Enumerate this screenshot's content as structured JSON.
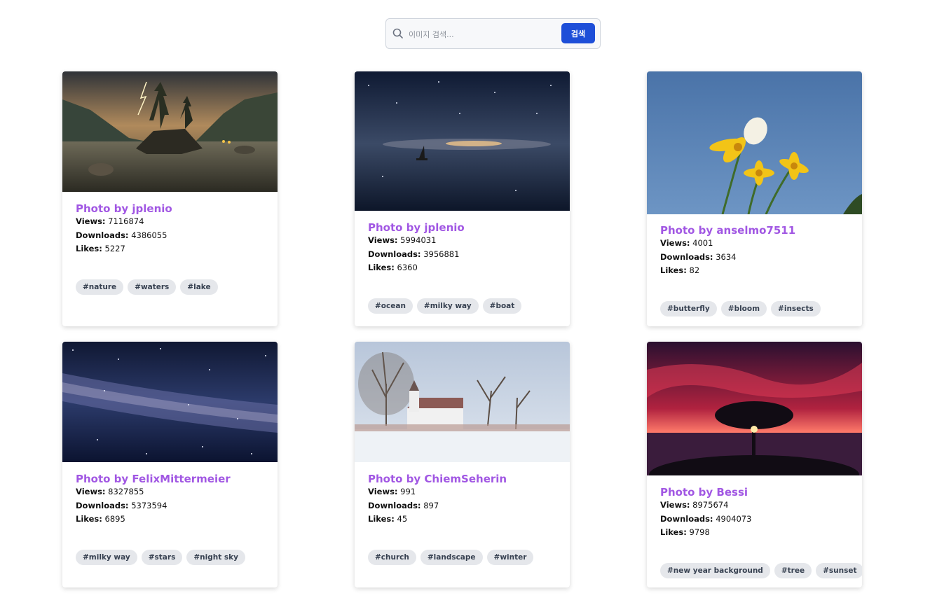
{
  "search": {
    "placeholder": "이미지 검색...",
    "value": "",
    "button_label": "검색"
  },
  "labels": {
    "views": "Views:",
    "downloads": "Downloads:",
    "likes": "Likes:"
  },
  "cards": [
    {
      "title": "Photo by jplenio",
      "views": "7116874",
      "downloads": "4386055",
      "likes": "5227",
      "tags": [
        "#nature",
        "#waters",
        "#lake"
      ],
      "image": "mountain lake with lightning"
    },
    {
      "title": "Photo by jplenio",
      "views": "5994031",
      "downloads": "3956881",
      "likes": "6360",
      "tags": [
        "#ocean",
        "#milky way",
        "#boat"
      ],
      "image": "sailboat under starry sky"
    },
    {
      "title": "Photo by anselmo7511",
      "views": "4001",
      "downloads": "3634",
      "likes": "82",
      "tags": [
        "#butterfly",
        "#bloom",
        "#insects"
      ],
      "image": "butterfly on yellow flowers"
    },
    {
      "title": "Photo by FelixMittermeier",
      "views": "8327855",
      "downloads": "5373594",
      "likes": "6895",
      "tags": [
        "#milky way",
        "#stars",
        "#night sky"
      ],
      "image": "milky way"
    },
    {
      "title": "Photo by ChiemSeherin",
      "views": "991",
      "downloads": "897",
      "likes": "45",
      "tags": [
        "#church",
        "#landscape",
        "#winter"
      ],
      "image": "church in winter landscape"
    },
    {
      "title": "Photo by Bessi",
      "views": "8975674",
      "downloads": "4904073",
      "likes": "9798",
      "tags": [
        "#new year background",
        "#tree",
        "#sunset"
      ],
      "image": "tree silhouette at red sunset"
    }
  ]
}
